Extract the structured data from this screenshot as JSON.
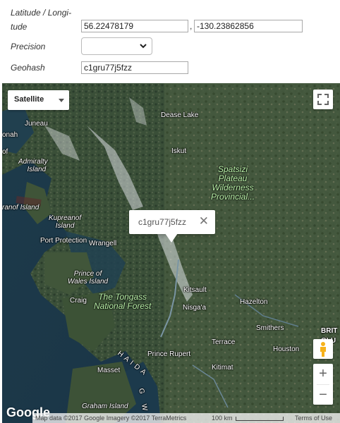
{
  "form": {
    "latlng_label_line1": "Latitude / Longi-",
    "latlng_label_line2": "tude",
    "latitude_value": "56.22478179",
    "separator": ",",
    "longitude_value": "-130.23862856",
    "precision_label": "Precision",
    "precision_value": "",
    "geohash_label": "Geohash",
    "geohash_value": "c1gru77j5fzz"
  },
  "map": {
    "map_type_label": "Satellite",
    "popup_text": "c1gru77j5fzz",
    "popup_close": "✕",
    "zoom_in": "+",
    "zoom_out": "−",
    "logo": "Google",
    "attribution": "Map data ©2017 Google Imagery ©2017 TerraMetrics",
    "scale": "100 km",
    "terms": "Terms of Use",
    "places": {
      "juneau": "Juneau",
      "dease_lake": "Dease Lake",
      "iskut": "Iskut",
      "admiralty1": "Admiralty",
      "admiralty2": "Island",
      "ranof": "ranof Island",
      "kupreanof1": "Kupreanof",
      "kupreanof2": "Island",
      "port_protection": "Port Protection",
      "wrangell": "Wrangell",
      "prince_wales1": "Prince of",
      "prince_wales2": "Wales Island",
      "craig": "Craig",
      "kitsault": "Kitsault",
      "nisgaa": "Nisga'a",
      "hazelton": "Hazelton",
      "smithers": "Smithers",
      "terrace": "Terrace",
      "houston": "Houston",
      "prince_rupert": "Prince Rupert",
      "kitimat": "Kitimat",
      "masset": "Masset",
      "graham": "Graham Island",
      "haida": "H A I D A",
      "gw": "G W",
      "onah": "onah",
      "of": "of",
      "brit": "BRIT",
      "olu": "OLU"
    },
    "parks": {
      "spatsizi_1": "Spatsizi",
      "spatsizi_2": "Plateau",
      "spatsizi_3": "Wilderness",
      "spatsizi_4": "Provincial...",
      "tongass_1": "The Tongass",
      "tongass_2": "National Forest"
    }
  }
}
